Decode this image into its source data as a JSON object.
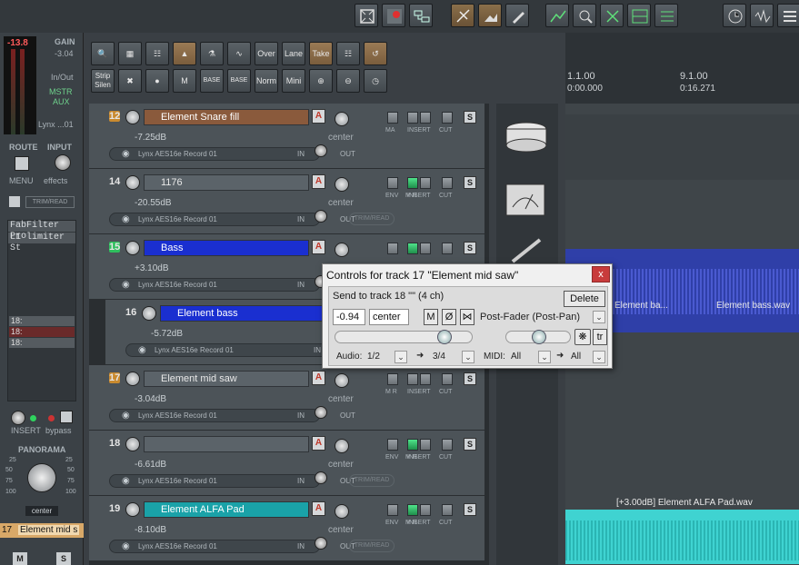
{
  "toolbar_top": {
    "buttons": [
      "full-screen-icon",
      "record-arm-icon",
      "link-icon",
      "glue-icon",
      "crop-icon",
      "pencil-icon",
      "envelope-icon",
      "zoom-icon",
      "split-icon",
      "grid-icon",
      "quantize-icon",
      "clock-icon",
      "wave-icon",
      "list-icon"
    ]
  },
  "mcp": {
    "peak": "-13.8",
    "gain_label": "GAIN",
    "gain_value": "-3.04",
    "inout": "In/Out",
    "mstr": "MSTR",
    "aux": "AUX",
    "device": "Lynx ...01",
    "route": "ROUTE",
    "input": "INPUT",
    "menu": "MENU",
    "effects": "effects",
    "trim_read": "TRIM/READ",
    "fx1": "FabFilter Pro",
    "fx2": "L1 limiter St",
    "sends": [
      "18:",
      "18:",
      "18:"
    ],
    "insert": "INSERT",
    "bypass": "bypass",
    "panorama": "PANORAMA",
    "pan_left_ticks": [
      "25",
      "50",
      "75",
      "100"
    ],
    "pan_right_ticks": [
      "25",
      "50",
      "75",
      "100"
    ],
    "pan_value": "center",
    "track_num": "17",
    "track_name": "Element mid s",
    "m": "M",
    "s": "S"
  },
  "mid_toolbar": {
    "row1": [
      "search-icon",
      "grid-icon",
      "mixer-icon",
      "metronome-icon",
      "routing-icon",
      "envelope-icon",
      "Over",
      "Lane",
      "Take",
      "grid-lines-icon",
      "loop-icon"
    ],
    "row2": [
      "Strip\nSilen",
      "delete-icon",
      "record-icon",
      "mute-icon",
      "BASE",
      "BASE",
      "Norm",
      "Mini",
      "zoom-in-icon",
      "zoom-out-icon",
      "clock-icon"
    ]
  },
  "ruler": {
    "m1": "1.1.00",
    "t1": "0:00.000",
    "m2": "9.1.00",
    "t2": "0:16.271"
  },
  "tracks": [
    {
      "num": "12",
      "name": "Element Snare fill",
      "color": "#8a5a3c",
      "db": "-7.25dB",
      "fx": "Lynx AES16e Record 01",
      "in": "IN",
      "out": "OUT",
      "pan": "center",
      "rec": "orange",
      "show_trim": false,
      "labels": [
        "MA",
        "INSERT",
        "CUT"
      ]
    },
    {
      "num": "14",
      "name": "1176",
      "color": "",
      "db": "-20.55dB",
      "fx": "Lynx AES16e Record 01",
      "in": "IN",
      "out": "OUT",
      "pan": "center",
      "rec": "none",
      "show_trim": true,
      "trim": "TRIM/READ",
      "labels": [
        "ENV",
        "M R",
        "INSERT",
        "CUT"
      ]
    },
    {
      "num": "15",
      "name": "Bass",
      "color": "#1a2fd0",
      "db": "+3.10dB",
      "fx": "Lynx AES16e Record 01",
      "in": "IN",
      "out": "OUT",
      "pan": "center",
      "rec": "green",
      "show_trim": false,
      "labels": []
    },
    {
      "num": "16",
      "name": "Element bass",
      "color": "#1a2fd0",
      "db": "-5.72dB",
      "fx": "Lynx AES16e Record 01",
      "in": "IN",
      "out": "OUT",
      "pan": "",
      "rec": "none",
      "show_trim": false,
      "labels": []
    },
    {
      "num": "17",
      "name": "Element mid saw",
      "color": "",
      "db": "-3.04dB",
      "fx": "Lynx AES16e Record 01",
      "in": "IN",
      "out": "OUT",
      "pan": "center",
      "rec": "orange",
      "show_trim": false,
      "labels": [
        "M R",
        "INSERT",
        "CUT"
      ]
    },
    {
      "num": "18",
      "name": "",
      "color": "",
      "db": "-6.61dB",
      "fx": "Lynx AES16e Record 01",
      "in": "IN",
      "out": "OUT",
      "pan": "center",
      "rec": "none",
      "show_trim": true,
      "trim": "TRIM/READ",
      "labels": [
        "ENV",
        "M R",
        "INSERT",
        "CUT"
      ]
    },
    {
      "num": "19",
      "name": "Element ALFA Pad",
      "color": "#1aa2a8",
      "db": "-8.10dB",
      "fx": "Lynx AES16e Record 01",
      "in": "IN",
      "out": "OUT",
      "pan": "center",
      "rec": "none",
      "show_trim": true,
      "trim": "TRIM/READ",
      "labels": [
        "ENV",
        "M R",
        "INSERT",
        "CUT"
      ]
    }
  ],
  "items": {
    "bass_item1": "Element ba...",
    "bass_item2": "Element bass.wav",
    "pad_item": "[+3.00dB] Element ALFA Pad.wav"
  },
  "dialog": {
    "title": "Controls for track 17 \"Element mid saw\"",
    "close": "x",
    "send_label": "Send to track 18 \"\" (4 ch)",
    "delete": "Delete",
    "volume": "-0.94",
    "pan": "center",
    "m": "M",
    "phase": "Ø",
    "mono": "stereo-icon",
    "mode": "Post-Fader (Post-Pan)",
    "audio_label": "Audio:",
    "audio_src": "1/2",
    "audio_dst": "3/4",
    "midi_label": "MIDI:",
    "midi_src": "All",
    "midi_dst": "All",
    "tr": "tr",
    "volume_fader_level": 0.82,
    "pan_fader_level": 0.5
  },
  "colors": {
    "track_orange": "#8a5a3c",
    "track_blue": "#1a2fd0",
    "track_teal": "#1aa2a8",
    "item_blue": "#2f3fa8",
    "item_teal": "#3fd3d1"
  }
}
